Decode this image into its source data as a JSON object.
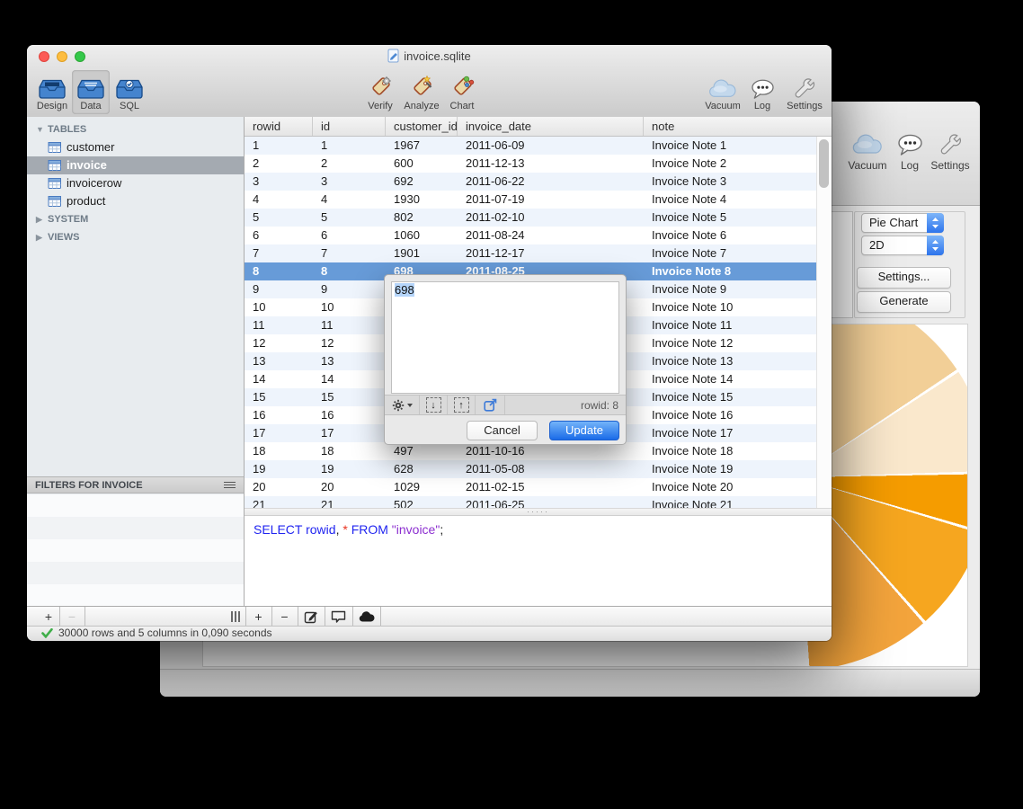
{
  "window": {
    "title": "invoice.sqlite",
    "toolbar": {
      "left": [
        {
          "label": "Design",
          "selected": false
        },
        {
          "label": "Data",
          "selected": true
        },
        {
          "label": "SQL",
          "selected": false
        }
      ],
      "middle": [
        {
          "label": "Verify"
        },
        {
          "label": "Analyze"
        },
        {
          "label": "Chart"
        }
      ],
      "right": [
        {
          "label": "Vacuum"
        },
        {
          "label": "Log"
        },
        {
          "label": "Settings"
        }
      ]
    },
    "sidebar": {
      "sections": [
        {
          "label": "TABLES",
          "expanded": true,
          "items": [
            "customer",
            "invoice",
            "invoicerow",
            "product"
          ],
          "selected_item": "invoice"
        },
        {
          "label": "SYSTEM",
          "expanded": false
        },
        {
          "label": "VIEWS",
          "expanded": false
        }
      ],
      "filters_header": "FILTERS FOR INVOICE"
    },
    "table": {
      "columns": [
        "rowid",
        "id",
        "customer_id",
        "invoice_date",
        "note"
      ],
      "selected_rowid": 8,
      "rows": [
        [
          "1",
          "1",
          "1967",
          "2011-06-09",
          "Invoice Note 1"
        ],
        [
          "2",
          "2",
          "600",
          "2011-12-13",
          "Invoice Note 2"
        ],
        [
          "3",
          "3",
          "692",
          "2011-06-22",
          "Invoice Note 3"
        ],
        [
          "4",
          "4",
          "1930",
          "2011-07-19",
          "Invoice Note 4"
        ],
        [
          "5",
          "5",
          "802",
          "2011-02-10",
          "Invoice Note 5"
        ],
        [
          "6",
          "6",
          "1060",
          "2011-08-24",
          "Invoice Note 6"
        ],
        [
          "7",
          "7",
          "1901",
          "2011-12-17",
          "Invoice Note 7"
        ],
        [
          "8",
          "8",
          "698",
          "2011-08-25",
          "Invoice Note 8"
        ],
        [
          "9",
          "9",
          "",
          "",
          "Invoice Note 9"
        ],
        [
          "10",
          "10",
          "",
          "",
          "Invoice Note 10"
        ],
        [
          "11",
          "11",
          "",
          "",
          "Invoice Note 11"
        ],
        [
          "12",
          "12",
          "",
          "",
          "Invoice Note 12"
        ],
        [
          "13",
          "13",
          "",
          "",
          "Invoice Note 13"
        ],
        [
          "14",
          "14",
          "",
          "",
          "Invoice Note 14"
        ],
        [
          "15",
          "15",
          "",
          "",
          "Invoice Note 15"
        ],
        [
          "16",
          "16",
          "",
          "",
          "Invoice Note 16"
        ],
        [
          "17",
          "17",
          "",
          "",
          "Invoice Note 17"
        ],
        [
          "18",
          "18",
          "497",
          "2011-10-16",
          "Invoice Note 18"
        ],
        [
          "19",
          "19",
          "628",
          "2011-05-08",
          "Invoice Note 19"
        ],
        [
          "20",
          "20",
          "1029",
          "2011-02-15",
          "Invoice Note 20"
        ],
        [
          "21",
          "21",
          "502",
          "2011-06-25",
          "Invoice Note 21"
        ]
      ]
    },
    "resize_dots": "·····",
    "sql_editor": {
      "query": "SELECT rowid, * FROM \"invoice\";",
      "tokens": [
        {
          "text": "SELECT rowid",
          "color": "#2125F0"
        },
        {
          "text": ", ",
          "color": "#202020"
        },
        {
          "text": "*",
          "color": "#E8321F"
        },
        {
          "text": " ",
          "color": "#202020"
        },
        {
          "text": "FROM ",
          "color": "#2125F0"
        },
        {
          "text": "\"invoice\"",
          "color": "#8C2FD0"
        },
        {
          "text": ";",
          "color": "#202020"
        }
      ]
    },
    "status_bar": {
      "text": "30000 rows and 5 columns in 0,090 seconds"
    },
    "dialog": {
      "value": "698",
      "rowid_label": "rowid: 8",
      "cancel_label": "Cancel",
      "update_label": "Update"
    }
  },
  "background_window": {
    "toolbar": [
      {
        "label": "Vacuum"
      },
      {
        "label": "Log"
      },
      {
        "label": "Settings"
      }
    ],
    "chart_type_select": "Pie Chart",
    "dimension_select": "2D",
    "settings_button": "Settings...",
    "generate_button": "Generate",
    "chart_data": {
      "type": "pie",
      "title": "",
      "legend": "none visible",
      "visible_region": "right half only; rest hidden behind front window",
      "slices": [
        {
          "color": "#F2CF97",
          "start_deg": 0,
          "end_deg": 57
        },
        {
          "color": "#FAE8CC",
          "start_deg": 57,
          "end_deg": 89
        },
        {
          "color": "#F59C00",
          "start_deg": 89,
          "end_deg": 107
        },
        {
          "color": "#F6A61F",
          "start_deg": 107,
          "end_deg": 139
        },
        {
          "color": "#F3A43C",
          "start_deg": 139,
          "end_deg": 177
        },
        {
          "color": "#F2CF97",
          "start_deg": 334,
          "end_deg": 360
        }
      ]
    }
  },
  "colors": {
    "selection_blue": "#679BD8",
    "row_stripe": "#EEF4FC",
    "sidebar_selected": "#A4AAB1",
    "update_button_top": "#74B4F9",
    "update_button_bottom": "#1A6BE8",
    "text_selection": "#B5D5FA",
    "status_check_green": "#3FAE49"
  }
}
